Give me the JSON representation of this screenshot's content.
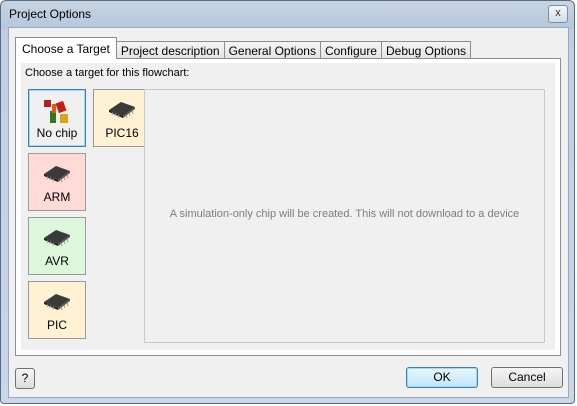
{
  "window": {
    "title": "Project Options",
    "close_label": "x"
  },
  "tabs": [
    {
      "label": "Choose a Target",
      "active": true
    },
    {
      "label": "Project description",
      "active": false
    },
    {
      "label": "General Options",
      "active": false
    },
    {
      "label": "Configure",
      "active": false
    },
    {
      "label": "Debug Options",
      "active": false
    }
  ],
  "target": {
    "prompt": "Choose a target for this flowchart:",
    "chips": [
      {
        "label": "No chip",
        "icon": "no-chip-icon",
        "color": "#ffffff",
        "selected": true
      },
      {
        "label": "PIC16",
        "icon": "chip-icon",
        "color": "#fff1d4",
        "selected": false
      },
      {
        "label": "ARM",
        "icon": "chip-icon",
        "color": "#ffdad6",
        "selected": false
      },
      {
        "label": "AVR",
        "icon": "chip-icon",
        "color": "#dcf7dc",
        "selected": false
      },
      {
        "label": "PIC",
        "icon": "chip-icon",
        "color": "#fff1d4",
        "selected": false
      }
    ],
    "description": "A simulation-only chip will be created. This will not download to a device"
  },
  "footer": {
    "help_label": "?",
    "ok_label": "OK",
    "cancel_label": "Cancel"
  }
}
